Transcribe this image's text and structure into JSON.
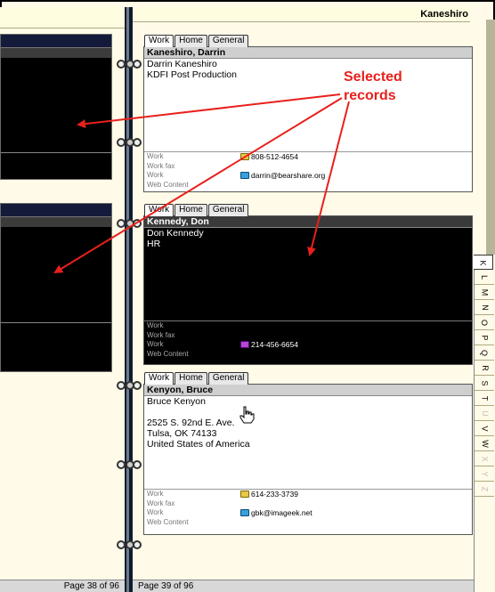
{
  "header": {
    "current_name": "Kaneshiro"
  },
  "annotation": {
    "line1": "Selected",
    "line2": "records"
  },
  "cards": [
    {
      "tabs": [
        "Work",
        "Home",
        "General"
      ],
      "active_tab": "Work",
      "title": "Kaneshiro, Darrin",
      "lines": [
        "Darrin Kaneshiro",
        "KDFI Post Production"
      ],
      "fields": [
        {
          "label": "Work",
          "value": "808-512-4654",
          "icon": "phone-icon"
        },
        {
          "label": "Work fax",
          "value": ""
        },
        {
          "label": "Work",
          "value": "darrin@bearshare.org",
          "icon": "email-icon"
        },
        {
          "label": "Web Content",
          "value": ""
        }
      ]
    },
    {
      "tabs": [
        "Work",
        "Home",
        "General"
      ],
      "active_tab": "Work",
      "title": "Kennedy, Don",
      "lines": [
        "Don Kennedy",
        "HR"
      ],
      "fields": [
        {
          "label": "Work",
          "value": ""
        },
        {
          "label": "Work fax",
          "value": ""
        },
        {
          "label": "Work",
          "value": "214-456-6654",
          "icon": "phone-icon"
        },
        {
          "label": "Web Content",
          "value": ""
        }
      ]
    },
    {
      "tabs": [
        "Work",
        "Home",
        "General"
      ],
      "active_tab": "Work",
      "title": "Kenyon, Bruce",
      "lines": [
        "Bruce Kenyon",
        "",
        "2525 S. 92nd E. Ave.",
        "Tulsa, OK 74133",
        "United States of America"
      ],
      "fields": [
        {
          "label": "Work",
          "value": "614-233-3739",
          "icon": "phone-icon"
        },
        {
          "label": "Work fax",
          "value": ""
        },
        {
          "label": "Work",
          "value": "gbk@imageek.net",
          "icon": "email-icon"
        },
        {
          "label": "Web Content",
          "value": ""
        }
      ]
    }
  ],
  "alpha_tabs": [
    "K",
    "L",
    "M",
    "N",
    "O",
    "P",
    "Q",
    "R",
    "S",
    "T",
    "U",
    "V",
    "W",
    "X",
    "Y",
    "Z"
  ],
  "alpha_active": "K",
  "alpha_dim": [
    "U",
    "X",
    "Y",
    "Z"
  ],
  "footer": {
    "left_page": "Page 38 of 96",
    "right_page": "Page 39 of 96"
  }
}
